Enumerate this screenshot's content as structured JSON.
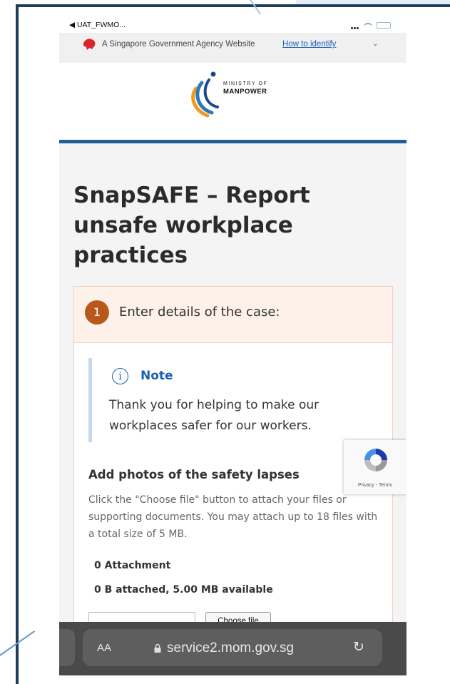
{
  "status_bar": {
    "back_app": "◀ UAT_FWMO..."
  },
  "gov_banner": {
    "text": "A Singapore Government Agency Website",
    "link": "How to identify",
    "chevron": "⌄"
  },
  "logo": {
    "line1": "MINISTRY OF",
    "line2": "MANPOWER"
  },
  "page": {
    "title": "SnapSAFE – Report unsafe workplace practices"
  },
  "step": {
    "number": "1",
    "label": "Enter details of the case:"
  },
  "note": {
    "icon": "i",
    "title": "Note",
    "body": "Thank you for helping to make our workplaces safer for our workers."
  },
  "photos": {
    "title": "Add photos of the safety lapses",
    "help": "Click the \"Choose file\" button to attach your files or supporting documents. You may attach up to 18 files with a total size of 5 MB.",
    "attachment_count": "0 Attachment",
    "attachment_size": "0 B attached, 5.00 MB available",
    "choose_label": "Choose file"
  },
  "recaptcha": {
    "text": "Privacy - Terms"
  },
  "browser": {
    "aa": "AA",
    "url": "service2.mom.gov.sg",
    "reload": "↻"
  },
  "colors": {
    "accent": "#1f5c99",
    "step_badge": "#b8581a",
    "link": "#1a5fb4"
  }
}
